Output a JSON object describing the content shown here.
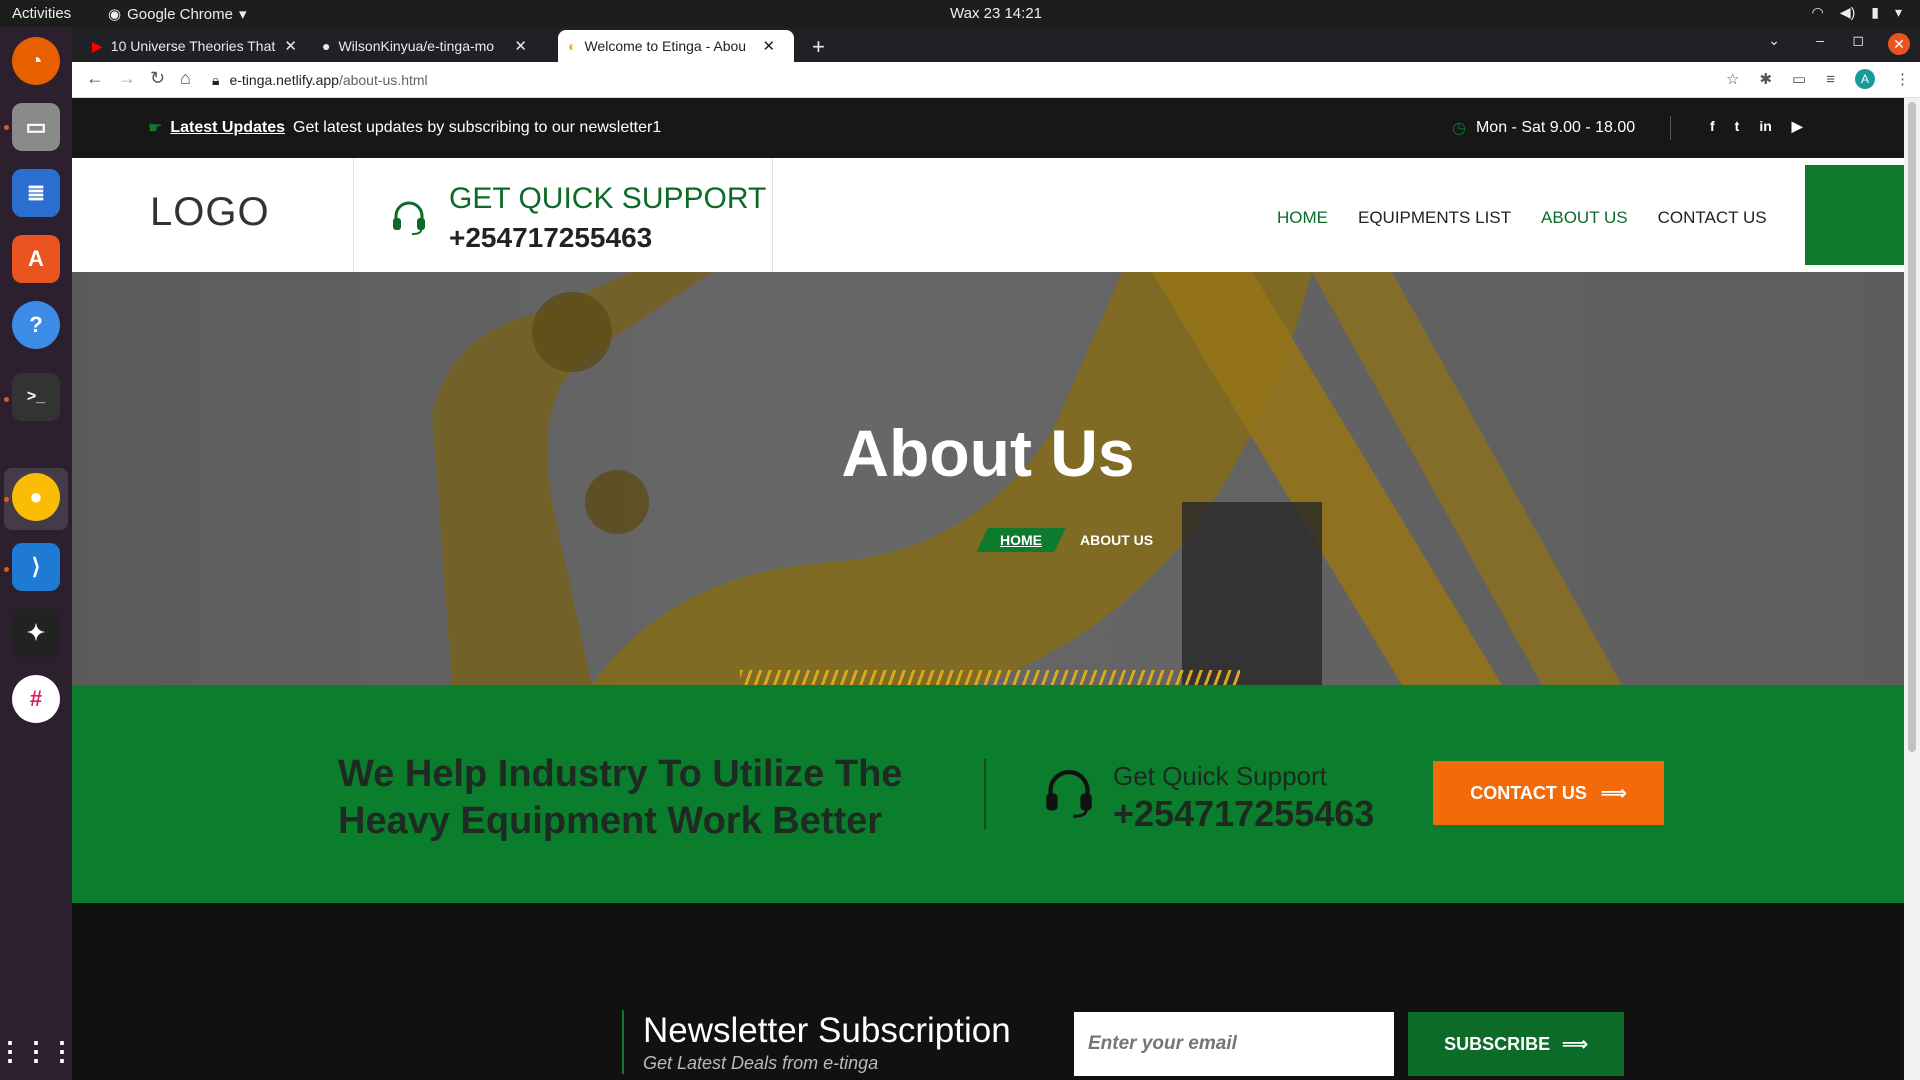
{
  "system": {
    "activities": "Activities",
    "app_name": "Google Chrome",
    "clock": "Wax 23  14:21"
  },
  "browser": {
    "tabs": [
      {
        "title": "10 Universe Theories That",
        "icon": "youtube-icon"
      },
      {
        "title": "WilsonKinyua/e-tinga-mo",
        "icon": "github-icon"
      },
      {
        "title": "Welcome to Etinga - Abou",
        "icon": "etinga-icon"
      }
    ],
    "url_host": "e-tinga.netlify.app",
    "url_path": "/about-us.html",
    "profile_initial": "A"
  },
  "page": {
    "updates": {
      "label": "Latest Updates",
      "text": "Get latest updates by subscribing to our newsletter1",
      "hours": "Mon - Sat 9.00 - 18.00",
      "social": [
        "facebook-icon",
        "twitter-icon",
        "linkedin-icon",
        "youtube-icon"
      ]
    },
    "header": {
      "logo": "LOGO",
      "support_title": "GET QUICK SUPPORT",
      "support_phone": "+254717255463",
      "nav": [
        "HOME",
        "EQUIPMENTS LIST",
        "ABOUT US",
        "CONTACT US"
      ],
      "nav_active": "ABOUT US"
    },
    "hero": {
      "title": "About Us",
      "breadcrumb_home": "HOME",
      "breadcrumb_current": "ABOUT US"
    },
    "cta": {
      "text": "We Help Industry To Utilize The Heavy Equipment Work Better",
      "support_label": "Get Quick Support",
      "phone": "+254717255463",
      "button": "CONTACT US"
    },
    "newsletter": {
      "title": "Newsletter Subscription",
      "subtitle": "Get Latest Deals from e-tinga",
      "placeholder": "Enter your email",
      "button": "SUBSCRIBE"
    }
  },
  "colors": {
    "brand_green": "#0d7a2e",
    "accent_orange": "#f26b0a",
    "dark": "#171717"
  }
}
